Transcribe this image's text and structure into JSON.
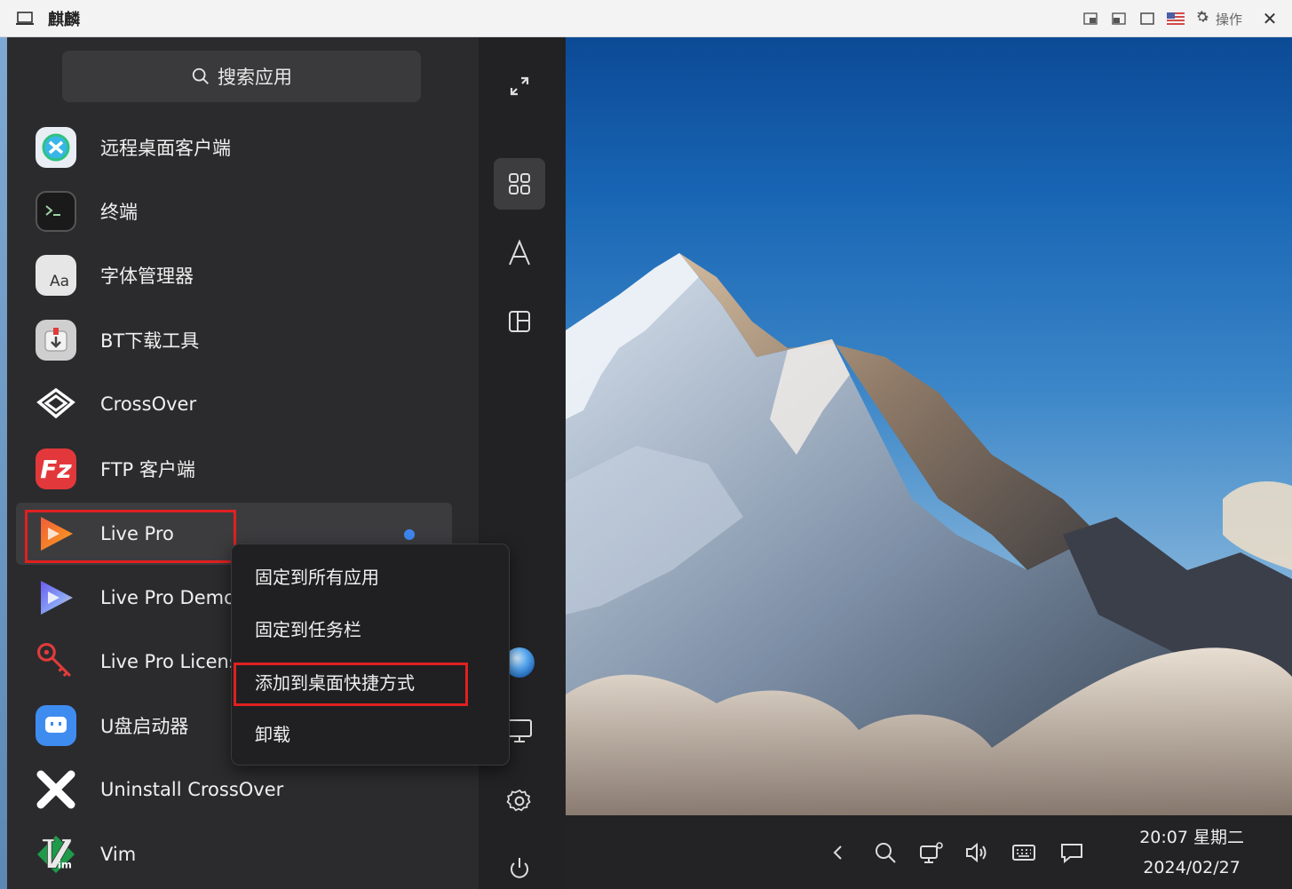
{
  "window": {
    "title": "麒麟",
    "action_label": "操作"
  },
  "search": {
    "placeholder": "搜索应用"
  },
  "apps": [
    {
      "label": "远程桌面客户端",
      "icon": "remote-desktop-icon"
    },
    {
      "label": "终端",
      "icon": "terminal-icon"
    },
    {
      "label": "字体管理器",
      "icon": "font-manager-icon"
    },
    {
      "label": "BT下载工具",
      "icon": "bt-download-icon"
    },
    {
      "label": "CrossOver",
      "icon": "crossover-icon"
    },
    {
      "label": "FTP 客户端",
      "icon": "filezilla-icon"
    },
    {
      "label": "Live Pro",
      "icon": "livepro-icon"
    },
    {
      "label": "Live Pro Demo",
      "icon": "livepro-demo-icon"
    },
    {
      "label": "Live Pro Licens",
      "icon": "key-icon"
    },
    {
      "label": "U盘启动器",
      "icon": "usb-launcher-icon"
    },
    {
      "label": "Uninstall CrossOver",
      "icon": "uninstall-icon"
    },
    {
      "label": "Vim",
      "icon": "vim-icon"
    }
  ],
  "context_menu": {
    "items": [
      "固定到所有应用",
      "固定到任务栏",
      "添加到桌面快捷方式",
      "卸载"
    ]
  },
  "sidebar": {
    "items": [
      "expand-icon",
      "grid-view-icon",
      "alphabet-sort-icon",
      "category-view-icon",
      "user-avatar-icon",
      "computer-icon",
      "settings-icon",
      "power-icon"
    ]
  },
  "taskbar": {
    "time": "20:07 星期二",
    "date": "2024/02/27"
  },
  "colors": {
    "highlight_border": "#e02020",
    "accent_dot": "#3e87f0",
    "menu_bg": "#2b2b2d"
  }
}
